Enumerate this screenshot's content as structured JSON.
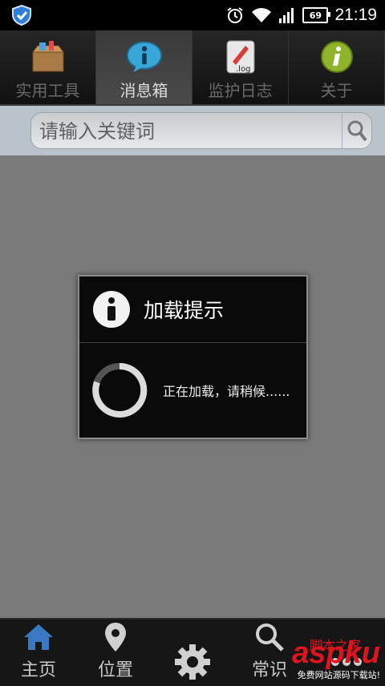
{
  "status_bar": {
    "time": "21:19",
    "battery": "69",
    "icons": [
      "shield-icon",
      "alarm-icon",
      "wifi-icon",
      "signal-icon",
      "battery-icon"
    ]
  },
  "tabs": [
    {
      "label": "实用工具",
      "icon": "toolbox-icon",
      "active": false
    },
    {
      "label": "消息箱",
      "icon": "info-bubble-icon",
      "active": true
    },
    {
      "label": "监护日志",
      "icon": "log-file-icon",
      "active": false
    },
    {
      "label": "关于",
      "icon": "about-icon",
      "active": false
    }
  ],
  "search": {
    "placeholder": "请输入关键词",
    "button_icon": "search-icon"
  },
  "dialog": {
    "title": "加载提示",
    "message": "正在加载，请稍候......",
    "icon": "info-icon"
  },
  "bottom_nav": [
    {
      "label": "主页",
      "icon": "home-icon"
    },
    {
      "label": "位置",
      "icon": "location-pin-icon"
    },
    {
      "label": "",
      "icon": "settings-gear-icon"
    },
    {
      "label": "常识",
      "icon": "search-icon"
    },
    {
      "label": "",
      "icon": "more-icon"
    }
  ],
  "watermark": {
    "main": "aspku",
    "cn": "脚本之家",
    "sub": "免费网站源码下载站!"
  },
  "colors": {
    "background": "#7a7a7a",
    "accent_blue": "#3b78c4",
    "watermark_red": "#e0141e"
  }
}
